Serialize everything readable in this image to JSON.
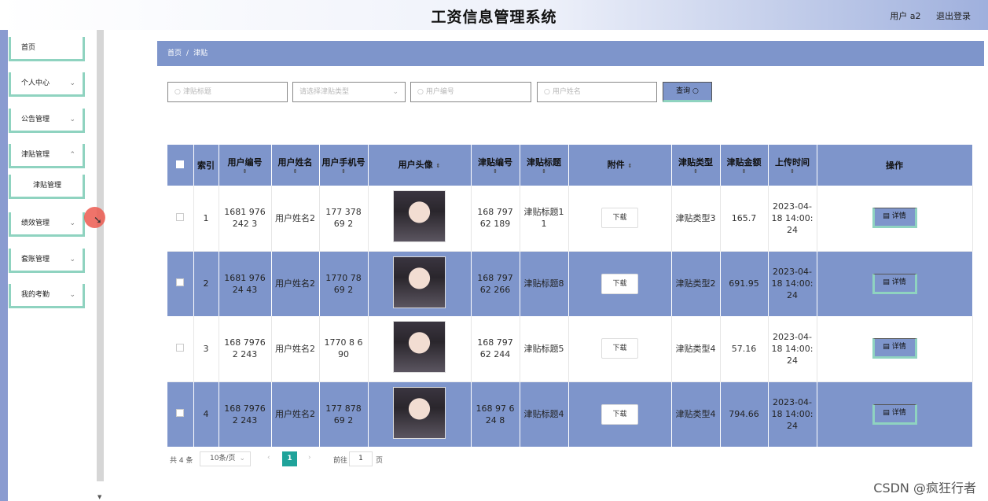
{
  "header": {
    "title": "工资信息管理系统",
    "user": "用户 a2",
    "logout": "退出登录"
  },
  "sidebar": {
    "items": [
      {
        "label": "首页",
        "chevron": ""
      },
      {
        "label": "个人中心",
        "chevron": "⌄"
      },
      {
        "label": "公告管理",
        "chevron": "⌄"
      },
      {
        "label": "津贴管理",
        "chevron": "⌃"
      },
      {
        "label": "津贴管理",
        "chevron": ""
      },
      {
        "label": "绩效管理",
        "chevron": "⌄"
      },
      {
        "label": "套账管理",
        "chevron": "⌄"
      },
      {
        "label": "我的考勤",
        "chevron": "⌄"
      }
    ]
  },
  "breadcrumb": {
    "home": "首页",
    "sep": "/",
    "current": "津贴"
  },
  "search": {
    "title_placeholder": "津贴标题",
    "type_placeholder": "请选择津贴类型",
    "user_no_placeholder": "用户编号",
    "user_name_placeholder": "用户姓名",
    "button": "查询"
  },
  "table": {
    "headers": [
      "索引",
      "用户编号",
      "用户姓名",
      "用户手机号",
      "用户头像",
      "津贴编号",
      "津贴标题",
      "附件",
      "津贴类型",
      "津贴金额",
      "上传时间",
      "操作"
    ],
    "download_label": "下载",
    "detail_label": "详情",
    "rows": [
      {
        "index": "1",
        "user_no": "1681 976 242 3",
        "user_name": "用户姓名2",
        "phone": "177 378 69 2",
        "allowance_no": "168 797 62 189",
        "title": "津贴标题11",
        "type": "津贴类型3",
        "amount": "165.7",
        "time": "2023-04-18 14:00:24"
      },
      {
        "index": "2",
        "user_no": "1681 976 24 43",
        "user_name": "用户姓名2",
        "phone": "1770 78 69 2",
        "allowance_no": "168 797 62 266",
        "title": "津贴标题8",
        "type": "津贴类型2",
        "amount": "691.95",
        "time": "2023-04-18 14:00:24"
      },
      {
        "index": "3",
        "user_no": "168 7976 2 243",
        "user_name": "用户姓名2",
        "phone": "1770 8 690",
        "allowance_no": "168 797 62 244",
        "title": "津贴标题5",
        "type": "津贴类型4",
        "amount": "57.16",
        "time": "2023-04-18 14:00:24"
      },
      {
        "index": "4",
        "user_no": "168 7976 2 243",
        "user_name": "用户姓名2",
        "phone": "177 878 69 2",
        "allowance_no": "168 97 624 8",
        "title": "津贴标题4",
        "type": "津贴类型4",
        "amount": "794.66",
        "time": "2023-04-18 14:00:24"
      }
    ]
  },
  "pagination": {
    "total": "共 4 条",
    "page_size": "10条/页",
    "current_page": "1",
    "goto_prefix": "前往",
    "goto_value": "1",
    "goto_suffix": "页"
  },
  "watermark": "CSDN @疯狂行者",
  "colors": {
    "accent": "#7e95cb",
    "border_accent": "#8fd3c0",
    "page_active": "#1fa39a"
  }
}
